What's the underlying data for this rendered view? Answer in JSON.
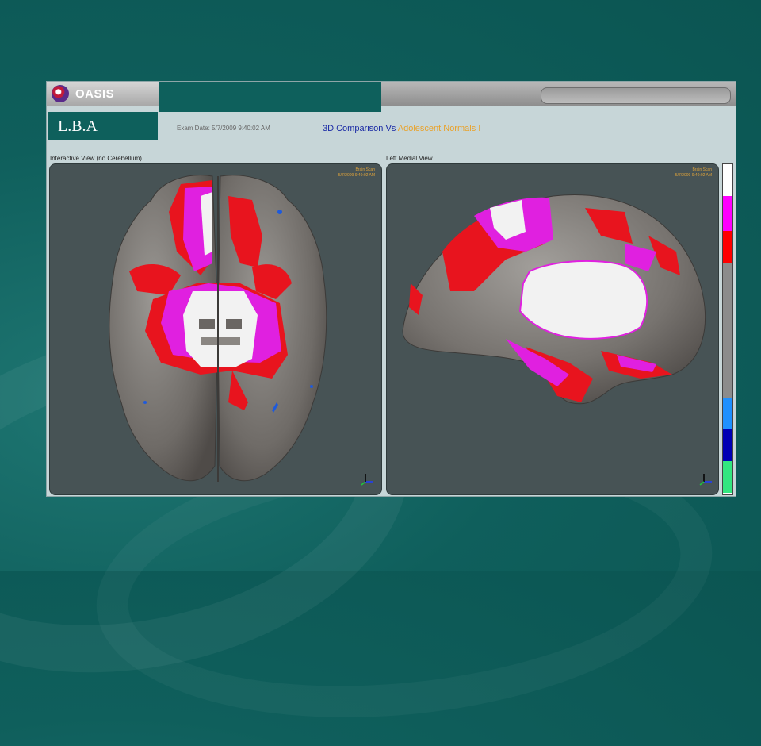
{
  "app": {
    "brand_name": "OASIS",
    "section_label": "L.B.A",
    "exam_date": "Exam Date: 5/7/2009 9:40:02 AM",
    "title_part1": "3D Comparison Vs ",
    "title_part2": "Adolescent Normals I"
  },
  "panels": {
    "left": {
      "label": "Interactive View (no Cerebellum)",
      "stamp_line1": "Brain Scan",
      "stamp_line2": "5/7/2009 9:40:02 AM"
    },
    "right": {
      "label": "Left Medial View",
      "stamp_line1": "Brain Scan",
      "stamp_line2": "5/7/2009 9:40:02 AM"
    }
  },
  "legend": {
    "colors": [
      "#ffffff",
      "#ff00ff",
      "#ff0000",
      "#8c8c8c",
      "#1e90ff",
      "#0000b4",
      "#33e680"
    ]
  },
  "colors": {
    "background": "#0e605c",
    "brain_gray": "#7a7672",
    "activation_red": "#e8141e",
    "activation_magenta": "#e020e0",
    "activation_white": "#f2f2f2",
    "title_blue": "#1a2aa5",
    "title_orange": "#e9a22a"
  }
}
